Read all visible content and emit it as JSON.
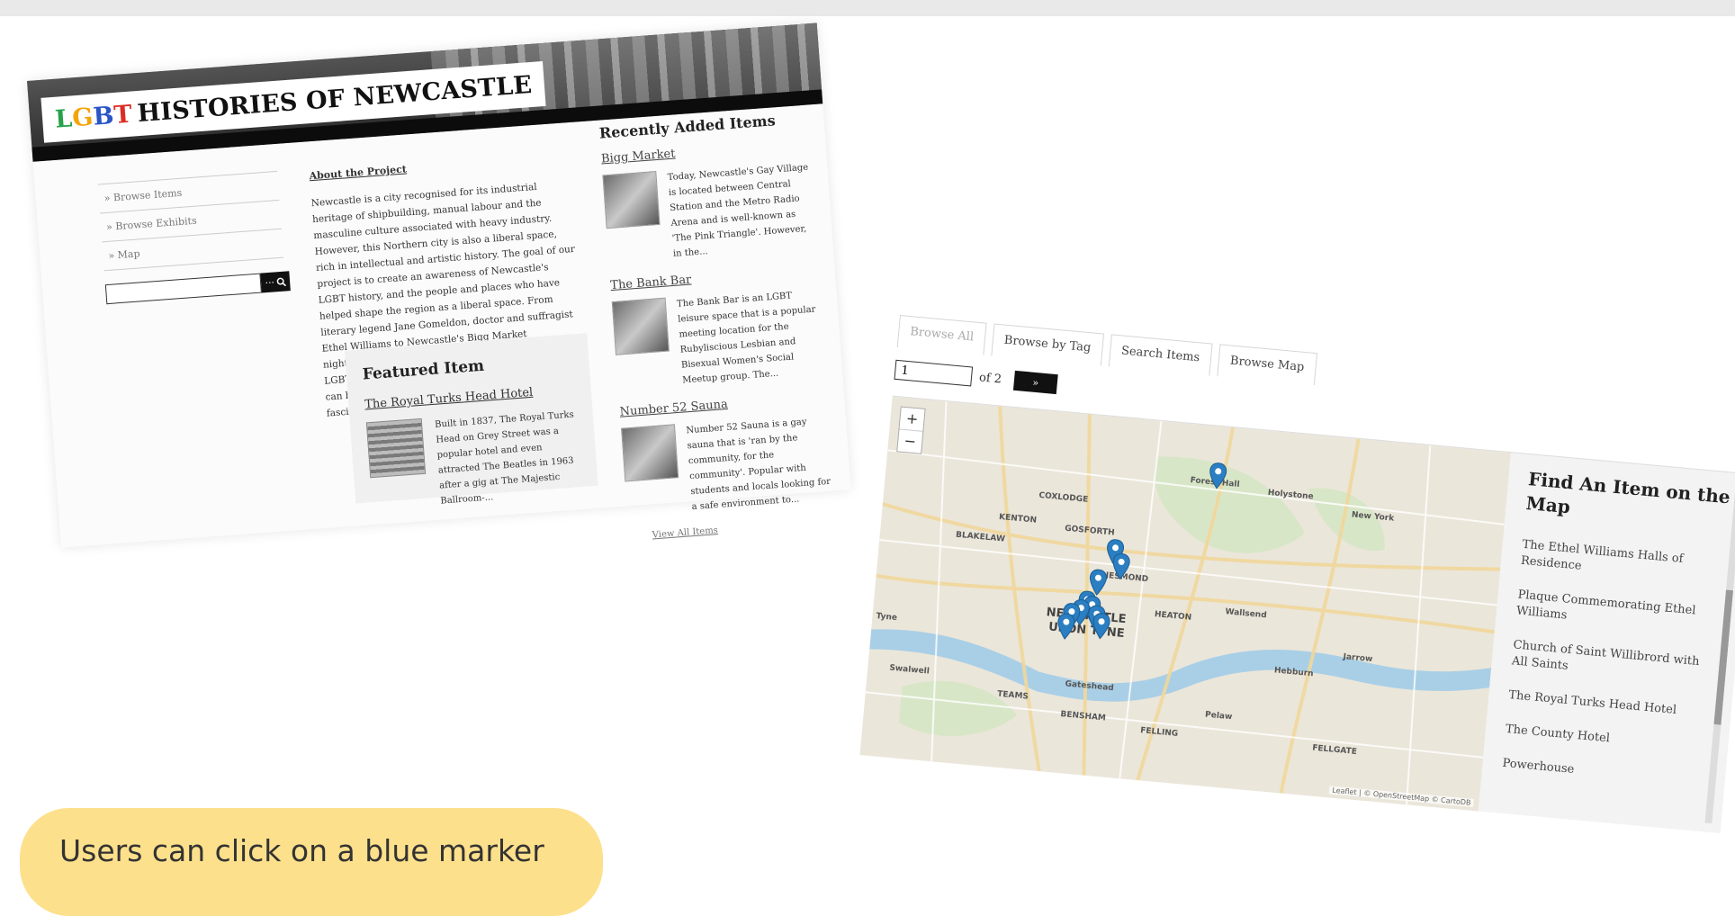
{
  "site": {
    "logo": {
      "l1": "L",
      "l2": "G",
      "l3": "B",
      "l4": "T",
      "rest": "HISTORIES OF NEWCASTLE"
    },
    "nav": [
      "» Browse Items",
      "» Browse Exhibits",
      "» Map"
    ],
    "search": {
      "placeholder": "",
      "button_label": "···"
    },
    "about": {
      "heading": "About the Project",
      "text": "Newcastle is a city recognised for its industrial heritage of shipbuilding, manual labour and the masculine culture associated with heavy industry. However, this Northern city is also a liberal space, rich in intellectual and artistic history. The goal of our project is to create an awareness of Newcastle's LGBT history, and the people and places who have helped shape the region as a liberal space. From literary legend Jane Gomeldon, doctor and suffragist Ethel Williams to Newcastle's Bigg Market nightclubs-- each are part of the long history of the LGBT community's struggle for equality. Here, you can browse exhibitions and read more about these fascinating individuals and spaces."
    },
    "featured": {
      "heading": "Featured Item",
      "title": "The Royal Turks Head Hotel",
      "desc": "Built in 1837, The Royal Turks Head on Grey Street was a popular hotel and even attracted The Beatles in 1963 after a gig at The Majestic Ballroom-..."
    },
    "recent": {
      "heading": "Recently Added Items",
      "items": [
        {
          "title": "Bigg Market",
          "desc": "Today, Newcastle's Gay Village is located between Central Station and the Metro Radio Arena and is well-known as 'The Pink Triangle'. However, in the..."
        },
        {
          "title": "The Bank Bar",
          "desc": "The Bank Bar is an LGBT leisure space that is a popular meeting location for the Rubyliscious Lesbian and Bisexual Women's Social Meetup group. The..."
        },
        {
          "title": "Number 52 Sauna",
          "desc": "Number 52 Sauna is a gay sauna that is 'ran by the community, for the community'. Popular with students and locals looking for a safe environment to..."
        }
      ],
      "view_all": "View All Items"
    }
  },
  "browse": {
    "tabs": [
      "Browse All",
      "Browse by Tag",
      "Search Items",
      "Browse Map"
    ],
    "active_tab": "Browse All",
    "pager": {
      "page": "1",
      "of_text": "of 2",
      "next": "»"
    },
    "map": {
      "zoom_in": "+",
      "zoom_out": "−",
      "labels": {
        "forest_hall": "Forest Hall",
        "holystone": "Holystone",
        "new_york": "New York",
        "coxlodge": "COXLODGE",
        "kenton": "KENTON",
        "gosforth": "GOSFORTH",
        "blakelaw": "BLAKELAW",
        "jesmond": "JESMOND",
        "wallsend": "Wallsend",
        "heaton": "HEATON",
        "newcastle": "NEWCASTLE",
        "upon_tyne": "UPON TYNE",
        "hebburn": "Hebburn",
        "jarrow": "Jarrow",
        "tyne": "Tyne",
        "swalwell": "Swalwell",
        "teams": "TEAMS",
        "gateshead": "Gateshead",
        "pelaw": "Pelaw",
        "bensham": "BENSHAM",
        "felling": "FELLING",
        "fellgate": "FELLGATE"
      },
      "marker_count": 11,
      "marker_color": "#2b7ec1",
      "attribution": "Leaflet | © OpenStreetMap © CartoDB"
    },
    "list": {
      "heading": "Find An Item on the Map",
      "items": [
        "The Ethel Williams Halls of Residence",
        "Plaque Commemorating Ethel Williams",
        "Church of Saint Willibrord with All Saints",
        "The Royal Turks Head Hotel",
        "The County Hotel",
        "Powerhouse"
      ]
    }
  },
  "caption": "Users can click on a blue marker"
}
